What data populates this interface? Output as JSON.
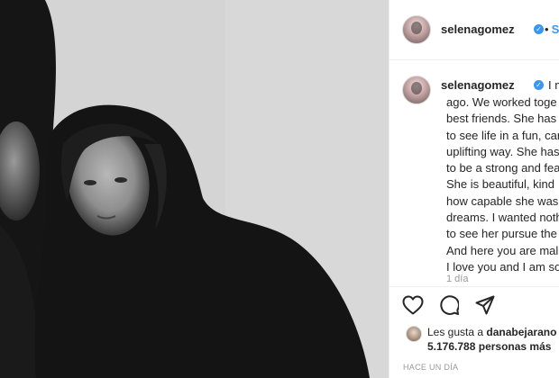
{
  "post": {
    "username": "selenagomez",
    "verified_badge": "✓",
    "header_separator": "•",
    "follow_label": "Sig",
    "caption_lead": "I me",
    "caption_lines": [
      "ago. We worked toge",
      "best friends. She has t",
      "to see life in a fun, car",
      "uplifting way. She has",
      "to be a strong and fea",
      "She is beautiful, kind",
      "how capable she was",
      "dreams. I wanted noth",
      "to see her pursue the",
      "And here you are mal",
      "I love you and I am so"
    ],
    "caption_time": "1 día",
    "likes_prefix": "Les gusta a",
    "likes_user": "danabejarano",
    "likes_count": "5.176.788",
    "likes_suffix": "personas más",
    "posted_time": "HACE UN DÍA"
  },
  "icons": {
    "like": "heart-icon",
    "comment": "comment-icon",
    "share": "share-icon",
    "verified": "verified-badge-icon"
  },
  "colors": {
    "accent": "#3897f0",
    "text": "#262626",
    "muted": "#999999",
    "border": "#efefef"
  }
}
